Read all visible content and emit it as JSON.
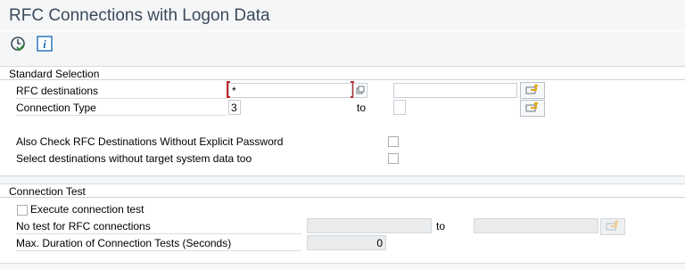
{
  "window": {
    "title": "RFC Connections with Logon Data"
  },
  "toolbar": {
    "execute_icon": "execute-clock-icon",
    "info_icon": "info-icon",
    "info_glyph": "i"
  },
  "standard_selection": {
    "title": "Standard Selection",
    "rfc_destinations": {
      "label": "RFC destinations",
      "from_value": "*",
      "to_value": ""
    },
    "connection_type": {
      "label": "Connection Type",
      "from_value": "3",
      "to_label": "to",
      "to_value": ""
    },
    "check_without_password": {
      "label": "Also Check RFC Destinations Without Explicit Password",
      "checked": false
    },
    "without_target_system": {
      "label": "Select destinations without target system data too",
      "checked": false
    }
  },
  "connection_test": {
    "title": "Connection Test",
    "execute_test": {
      "label": "Execute connection test",
      "checked": false
    },
    "no_test_for": {
      "label": "No test for RFC connections",
      "from_value": "",
      "to_label": "to",
      "to_value": ""
    },
    "max_duration": {
      "label": "Max. Duration of Connection Tests (Seconds)",
      "value": "0"
    }
  },
  "colors": {
    "title_text": "#3a4a5c",
    "focus_bracket": "#c0282a",
    "multi_select_arrow": "#e6a817",
    "execute_green": "#2e8b3a",
    "info_blue": "#1f6fb8"
  }
}
